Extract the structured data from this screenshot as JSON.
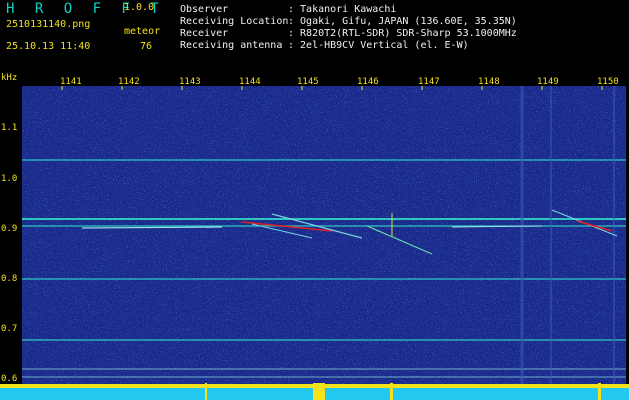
{
  "header": {
    "app_title": "H R O F F T",
    "version": "1.0.0",
    "file_name": "2510131140.png",
    "meteor_label": "meteor",
    "timestamp": "25.10.13 11:40",
    "meteor_count": "76",
    "fields": [
      {
        "label": "Observer",
        "value": ": Takanori Kawachi"
      },
      {
        "label": "Receiving Location",
        "value": ": Ogaki, Gifu, JAPAN (136.60E, 35.35N)"
      },
      {
        "label": "Receiver",
        "value": ": R820T2(RTL-SDR) SDR-Sharp 53.1000MHz"
      },
      {
        "label": "Receiving antenna",
        "value": ": 2el-HB9CV Vertical (el. E-W)"
      }
    ]
  },
  "axes": {
    "y_unit": "kHz",
    "x_ticks": [
      "1141",
      "1142",
      "1143",
      "1144",
      "1145",
      "1146",
      "1147",
      "1148",
      "1149",
      "1150"
    ],
    "y_ticks": [
      "1.1",
      "1.0",
      "0.9",
      "0.8",
      "0.7",
      "0.6"
    ]
  },
  "colors": {
    "background": "#000000",
    "spectrogram": "#1a2a8a",
    "axis_text": "#f4e21a",
    "title_text": "#0bd0c8",
    "header_text": "#f0f0f0",
    "meteor_trail": "#e02020",
    "footer_bar_yellow": "#f4e21a",
    "footer_bar_cyan": "#22c8f0"
  }
}
